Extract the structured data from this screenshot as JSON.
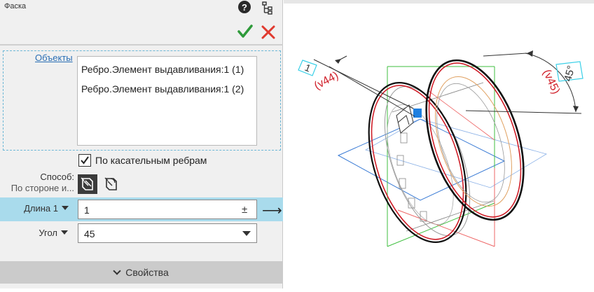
{
  "panel": {
    "title": "Фаска",
    "objects_label": "Объекты",
    "objects": [
      "Ребро.Элемент выдавливания:1 (1)",
      "Ребро.Элемент выдавливания:1 (2)"
    ],
    "tangent_checkbox": {
      "label": "По касательным ребрам",
      "checked": true
    },
    "method_label": "Способ:",
    "method_value": "По стороне и...",
    "length_label": "Длина 1",
    "length_value": "1",
    "length_pm": "±",
    "length_arrow": "⟶",
    "angle_label": "Угол",
    "angle_value": "45",
    "properties_label": "Свойства"
  },
  "viewport": {
    "dim_length_value": "1",
    "dim_length_text": "(v44)",
    "dim_angle_value": "45°",
    "dim_angle_text": "(v45)"
  },
  "icons": [
    "help-icon",
    "tree-icon",
    "check-icon",
    "close-icon",
    "method-side-icon",
    "method-angle-icon",
    "chevron-down-icon"
  ],
  "colors": {
    "accent_row": "#a9dbec",
    "ok": "#2e9a3a",
    "cancel": "#e03a2f",
    "link": "#2b6fb5",
    "dimension_red": "#d0202a",
    "dimension_cyan": "#3ad0e8"
  }
}
